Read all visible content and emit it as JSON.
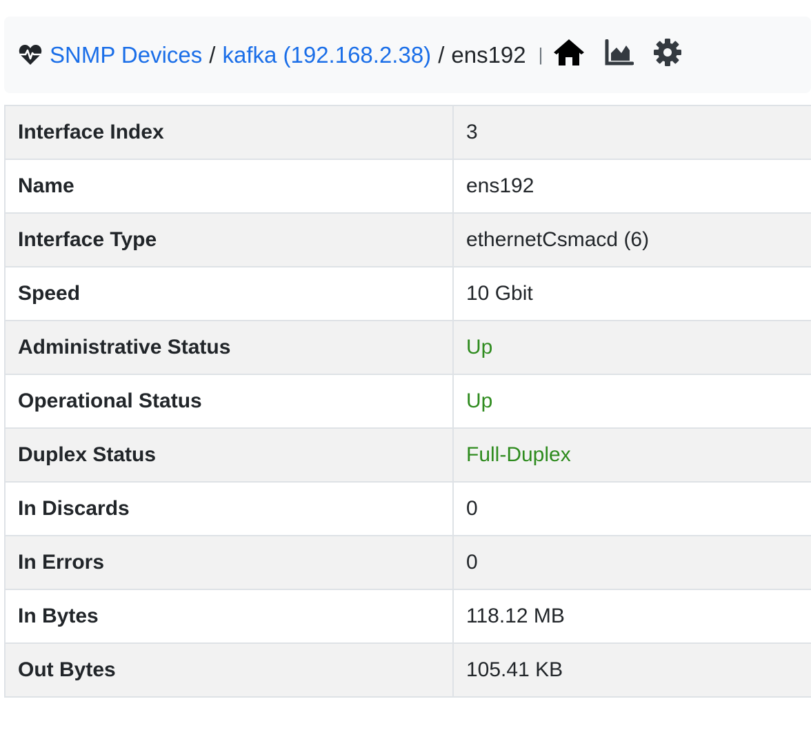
{
  "breadcrumb": {
    "root_label": "SNMP Devices",
    "device_label": "kafka (192.168.2.38)",
    "current_label": "ens192",
    "separator": "/",
    "divider": "|"
  },
  "toolbar": {
    "icons": [
      "home-icon",
      "area-chart-icon",
      "gear-icon"
    ]
  },
  "colors": {
    "link": "#1a6ee8",
    "status_up": "#2e8b1e",
    "bar_background": "#f8f9fa",
    "row_stripe": "#f2f2f2"
  },
  "rows": [
    {
      "label": "Interface Index",
      "value": "3"
    },
    {
      "label": "Name",
      "value": "ens192"
    },
    {
      "label": "Interface Type",
      "value": "ethernetCsmacd (6)"
    },
    {
      "label": "Speed",
      "value": "10 Gbit"
    },
    {
      "label": "Administrative Status",
      "value": "Up",
      "status": "ok"
    },
    {
      "label": "Operational Status",
      "value": "Up",
      "status": "ok"
    },
    {
      "label": "Duplex Status",
      "value": "Full-Duplex",
      "status": "ok"
    },
    {
      "label": "In Discards",
      "value": "0"
    },
    {
      "label": "In Errors",
      "value": "0"
    },
    {
      "label": "In Bytes",
      "value": "118.12 MB"
    },
    {
      "label": "Out Bytes",
      "value": "105.41 KB"
    }
  ]
}
